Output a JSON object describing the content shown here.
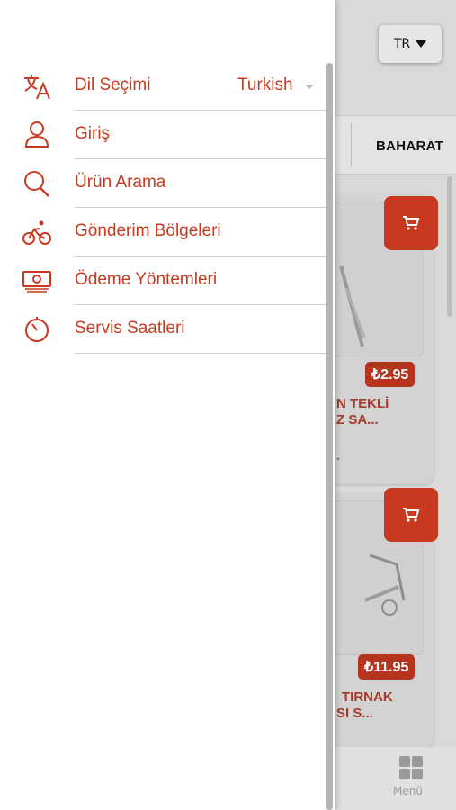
{
  "language_button": {
    "label": "TR"
  },
  "category": {
    "label": "BAHARAT"
  },
  "products": [
    {
      "price": "₺2.95",
      "name_line1": "N TEKLİ",
      "name_line2": "Z SA...",
      "name_line3": "."
    },
    {
      "price": "₺11.95",
      "name_line1": "TIRNAK",
      "name_line2": "SI S..."
    }
  ],
  "bottom_nav": {
    "menu_label": "Menü"
  },
  "drawer": {
    "items": [
      {
        "label": "Dil Seçimi",
        "icon": "translate-icon",
        "value": "Turkish"
      },
      {
        "label": "Giriş",
        "icon": "user-icon"
      },
      {
        "label": "Ürün Arama",
        "icon": "search-icon"
      },
      {
        "label": "Gönderim Bölgeleri",
        "icon": "bicycle-icon"
      },
      {
        "label": "Ödeme Yöntemleri",
        "icon": "cash-icon"
      },
      {
        "label": "Servis Saatleri",
        "icon": "timer-icon"
      }
    ]
  },
  "colors": {
    "accent": "#c9391f",
    "price_badge": "#b5341d",
    "product_name": "#a63a26"
  }
}
